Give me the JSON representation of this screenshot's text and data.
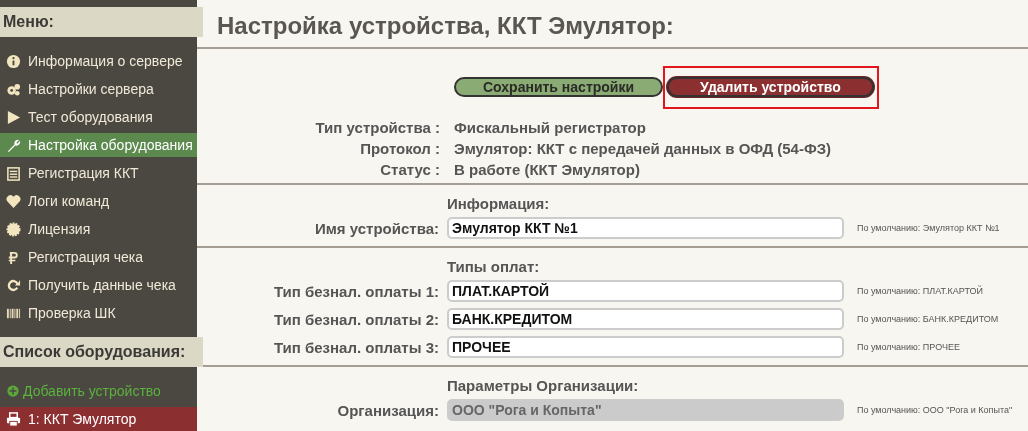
{
  "sidebar": {
    "menu_title": "Меню:",
    "items": [
      {
        "label": "Информация о сервере",
        "selected": false
      },
      {
        "label": "Настройки сервера",
        "selected": false
      },
      {
        "label": "Тест оборудования",
        "selected": false
      },
      {
        "label": "Настройка оборудования",
        "selected": true
      },
      {
        "label": "Регистрация ККТ",
        "selected": false
      },
      {
        "label": "Логи команд",
        "selected": false
      },
      {
        "label": "Лицензия",
        "selected": false
      },
      {
        "label": "Регистрация чека",
        "selected": false
      },
      {
        "label": "Получить данные чека",
        "selected": false
      },
      {
        "label": "Проверка ШК",
        "selected": false
      }
    ],
    "devices_title": "Список оборудования:",
    "devices": [
      {
        "kind": "add",
        "label": "Добавить устройство",
        "selected": false
      },
      {
        "kind": "device",
        "label": "1: ККТ Эмулятор",
        "selected": true
      }
    ]
  },
  "page": {
    "title": "Настройка устройства, ККТ Эмулятор:",
    "buttons": [
      {
        "kind": "save",
        "label": "Сохранить настройки",
        "highlighted": false
      },
      {
        "kind": "delete",
        "label": "Удалить устройство",
        "highlighted": true
      }
    ],
    "info": [
      {
        "label": "Тип устройства :",
        "value": "Фискальный регистратор"
      },
      {
        "label": "Протокол :",
        "value": "Эмулятор: ККТ с передачей данных в ОФД (54-ФЗ)"
      },
      {
        "label": "Статус :",
        "value": "В работе (ККТ Эмулятор)"
      }
    ],
    "sections": [
      {
        "title": "Информация:",
        "fields": [
          {
            "label": "Имя устройства:",
            "value": "Эмулятор ККТ №1",
            "disabled": false,
            "hint": "По умолчанию: Эмулятор ККТ №1"
          }
        ]
      },
      {
        "title": "Типы оплат:",
        "fields": [
          {
            "label": "Тип безнал. оплаты 1:",
            "value": "ПЛАТ.КАРТОЙ",
            "disabled": false,
            "hint": "По умолчанию: ПЛАТ.КАРТОЙ"
          },
          {
            "label": "Тип безнал. оплаты 2:",
            "value": "БАНК.КРЕДИТОМ",
            "disabled": false,
            "hint": "По умолчанию: БАНК.КРЕДИТОМ"
          },
          {
            "label": "Тип безнал. оплаты 3:",
            "value": "ПРОЧЕЕ",
            "disabled": false,
            "hint": "По умолчанию: ПРОЧЕЕ"
          }
        ]
      },
      {
        "title": "Параметры Организации:",
        "fields": [
          {
            "label": "Организация:",
            "value": "ООО \"Рога и Копыта\"",
            "disabled": true,
            "hint": "По умолчанию: ООО \"Рога и Копыта\""
          }
        ]
      }
    ]
  }
}
